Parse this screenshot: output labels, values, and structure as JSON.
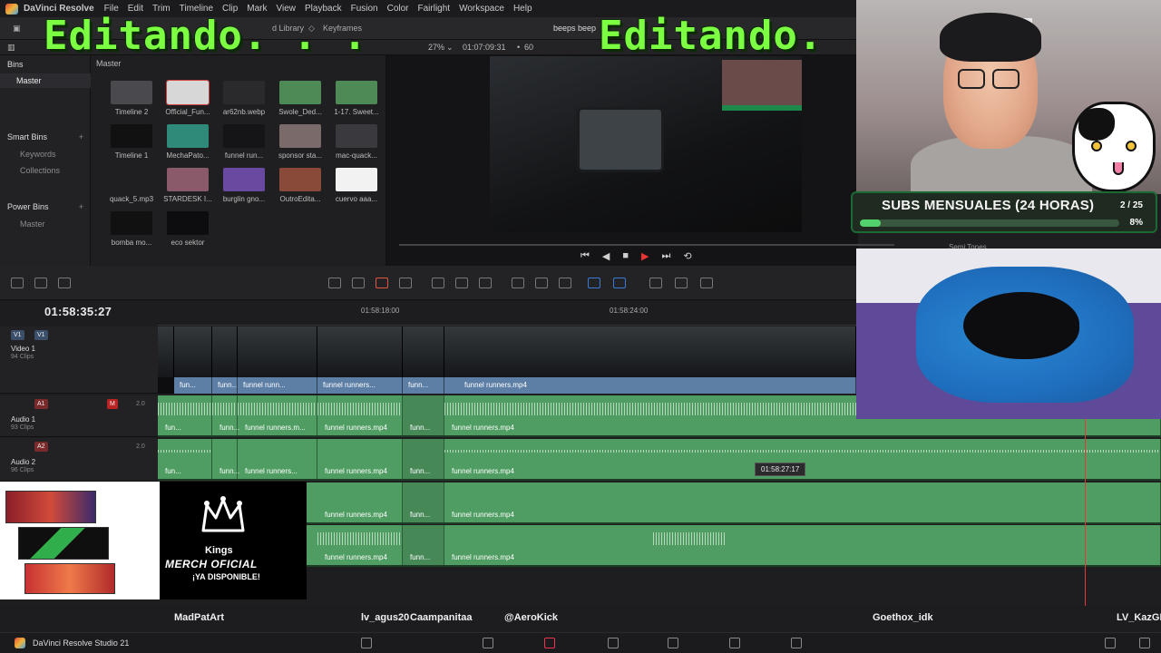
{
  "menu": {
    "app_name": "DaVinci Resolve",
    "items": [
      "File",
      "Edit",
      "Trim",
      "Timeline",
      "Clip",
      "Mark",
      "View",
      "Playback",
      "Fusion",
      "Color",
      "Fairlight",
      "Workspace",
      "Help"
    ]
  },
  "toolbar": {
    "sound_library": "d Library",
    "keyframes": "Keyframes",
    "project_name": "beeps beep"
  },
  "viewer_bar": {
    "zoom": "27%",
    "source_timecode": "01:07:09:31",
    "fps": "60"
  },
  "bins": {
    "title": "Bins",
    "master": "Master",
    "smart_bins": "Smart Bins",
    "keywords": "Keywords",
    "collections": "Collections",
    "power_bins": "Power Bins",
    "power_master": "Master"
  },
  "pool": {
    "breadcrumb": "Master",
    "clips": [
      {
        "label": "Timeline 2",
        "color": "#4a4a4e"
      },
      {
        "label": "Official_Fun...",
        "color": "#d7d7d7"
      },
      {
        "label": "ar62nb.webp",
        "color": "#2a2a2c"
      },
      {
        "label": "Swole_Ded...",
        "color": "#4e8a55"
      },
      {
        "label": "1-17. Sweet...",
        "color": "#4e8a55"
      },
      {
        "label": "Timeline 1",
        "color": "#111"
      },
      {
        "label": "MechaPato...",
        "color": "#2f8a7a"
      },
      {
        "label": "funnel run...",
        "color": "#151517"
      },
      {
        "label": "sponsor sta...",
        "color": "#7a6a6a"
      },
      {
        "label": "mac-quack...",
        "color": "#3a3a3e"
      },
      {
        "label": "quack_5.mp3",
        "color": "#1f1f21"
      },
      {
        "label": "STARDESK I...",
        "color": "#8a5a6a"
      },
      {
        "label": "burglin gno...",
        "color": "#6a4aa0"
      },
      {
        "label": "OutroEdita...",
        "color": "#8a4a3a"
      },
      {
        "label": "cuervo aaa...",
        "color": "#f2f2f2"
      },
      {
        "label": "bomba mo...",
        "color": "#111"
      },
      {
        "label": "eco sektor",
        "color": "#0d0d0f"
      }
    ]
  },
  "timeline": {
    "timecode": "01:58:35:27",
    "ruler_ticks": [
      "01:58:18:00",
      "01:58:24:00"
    ],
    "tooltip": "01:58:27:17",
    "video_track": {
      "code": "V1",
      "name": "Video 1",
      "clips": "94 Clips"
    },
    "audio1": {
      "code": "A1",
      "name": "Audio 1",
      "clips": "93 Clips",
      "level": "2.0"
    },
    "audio2": {
      "code": "A2",
      "name": "Audio 2",
      "clips": "96 Clips",
      "level": "2.0"
    },
    "clip_name": "funnel runners.mp4",
    "clip_short": "funn...",
    "clip_short2": "fun...",
    "clip_mid": "funnel runn...",
    "clip_mid2": "funnel runners...",
    "clip_mid3": "funnel runners.m..."
  },
  "overlays": {
    "headline_left": "Editando. . .",
    "headline_right": "Editando. .",
    "subs_title": "SUBS MENSUALES (24 HORAS)",
    "subs_count": "2 / 25",
    "subs_pct": "8%",
    "subs_fraction": 0.08,
    "semi_tones": "Semi Tones",
    "merch_brand": "Kings",
    "merch_line1": "MERCH OFICIAL",
    "merch_line2": "¡YA DISPONIBLE!"
  },
  "names": [
    "MadPatArt",
    "lv_agus20",
    "Caampanitaa",
    "@AeroKick",
    "Goethox_idk",
    "LV_KazGM"
  ],
  "status": {
    "brand": "DaVinci Resolve Studio 21"
  }
}
